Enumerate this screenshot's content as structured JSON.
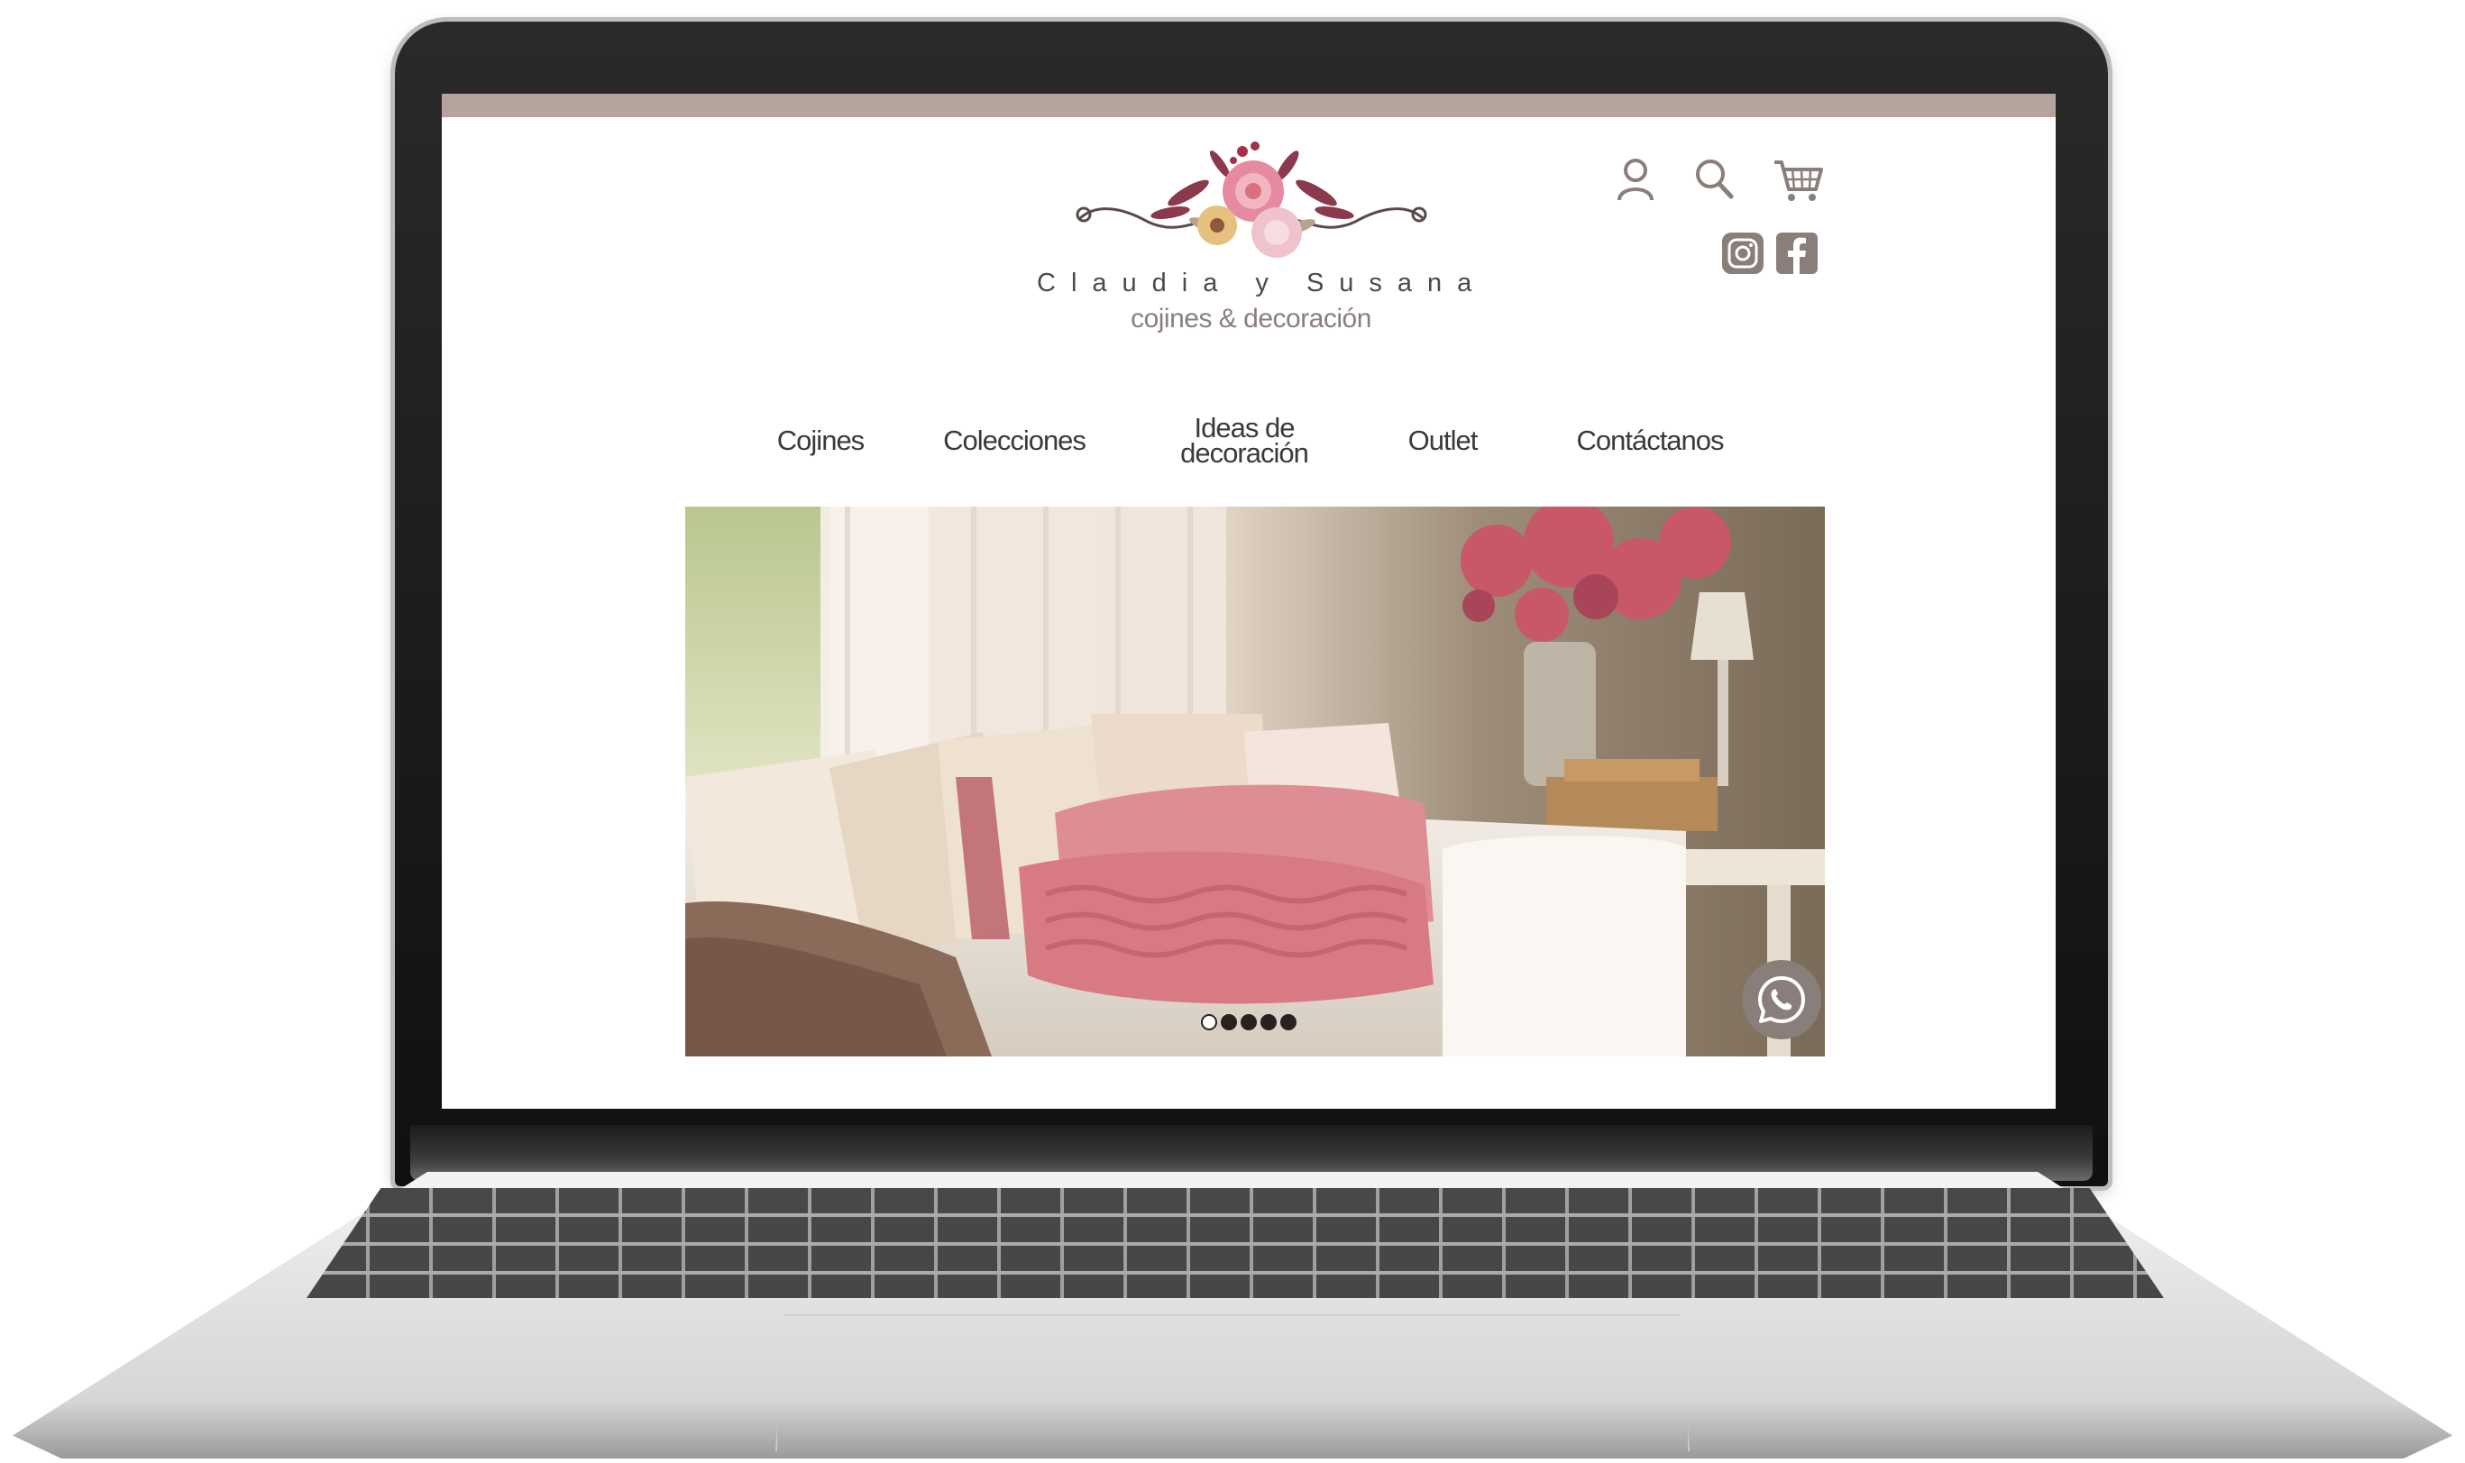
{
  "brand": {
    "name": "Claudia y Susana",
    "tagline": "cojines & decoración"
  },
  "header": {
    "icons": [
      "user-icon",
      "search-icon",
      "cart-icon",
      "instagram-icon",
      "facebook-icon"
    ]
  },
  "nav": {
    "items": [
      {
        "label": "Cojines"
      },
      {
        "label": "Colecciones"
      },
      {
        "label": "Ideas de",
        "label2": "decoración"
      },
      {
        "label": "Outlet"
      },
      {
        "label": "Contáctanos"
      }
    ]
  },
  "slider": {
    "slide_count": 5,
    "active_index": 0
  },
  "colors": {
    "top_strip": "#b5a49e",
    "icon": "#8a7e7a",
    "nav_text": "#3a3a3a",
    "accent_pink": "#d9707f"
  }
}
